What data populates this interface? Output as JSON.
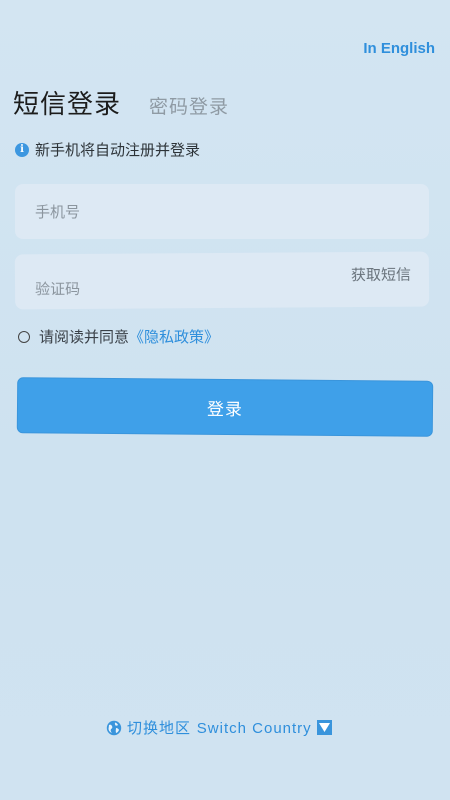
{
  "header": {
    "language_link": "In English"
  },
  "tabs": {
    "sms_login": "短信登录",
    "password_login": "密码登录"
  },
  "notice": {
    "text": "新手机将自动注册并登录",
    "icon": "info-icon"
  },
  "form": {
    "phone_placeholder": "手机号",
    "code_placeholder": "验证码",
    "get_code": "获取短信"
  },
  "agreement": {
    "text": "请阅读并同意",
    "policy_link": "《隐私政策》"
  },
  "login_button": "登录",
  "footer": {
    "region_label": "切换地区",
    "region_label_en": "Switch Country",
    "globe_icon": "globe-icon",
    "dropdown_icon": "triangle-down-icon"
  },
  "colors": {
    "accent": "#3fa0e9",
    "link": "#2f8fdc",
    "background": "#cfe2f0"
  }
}
